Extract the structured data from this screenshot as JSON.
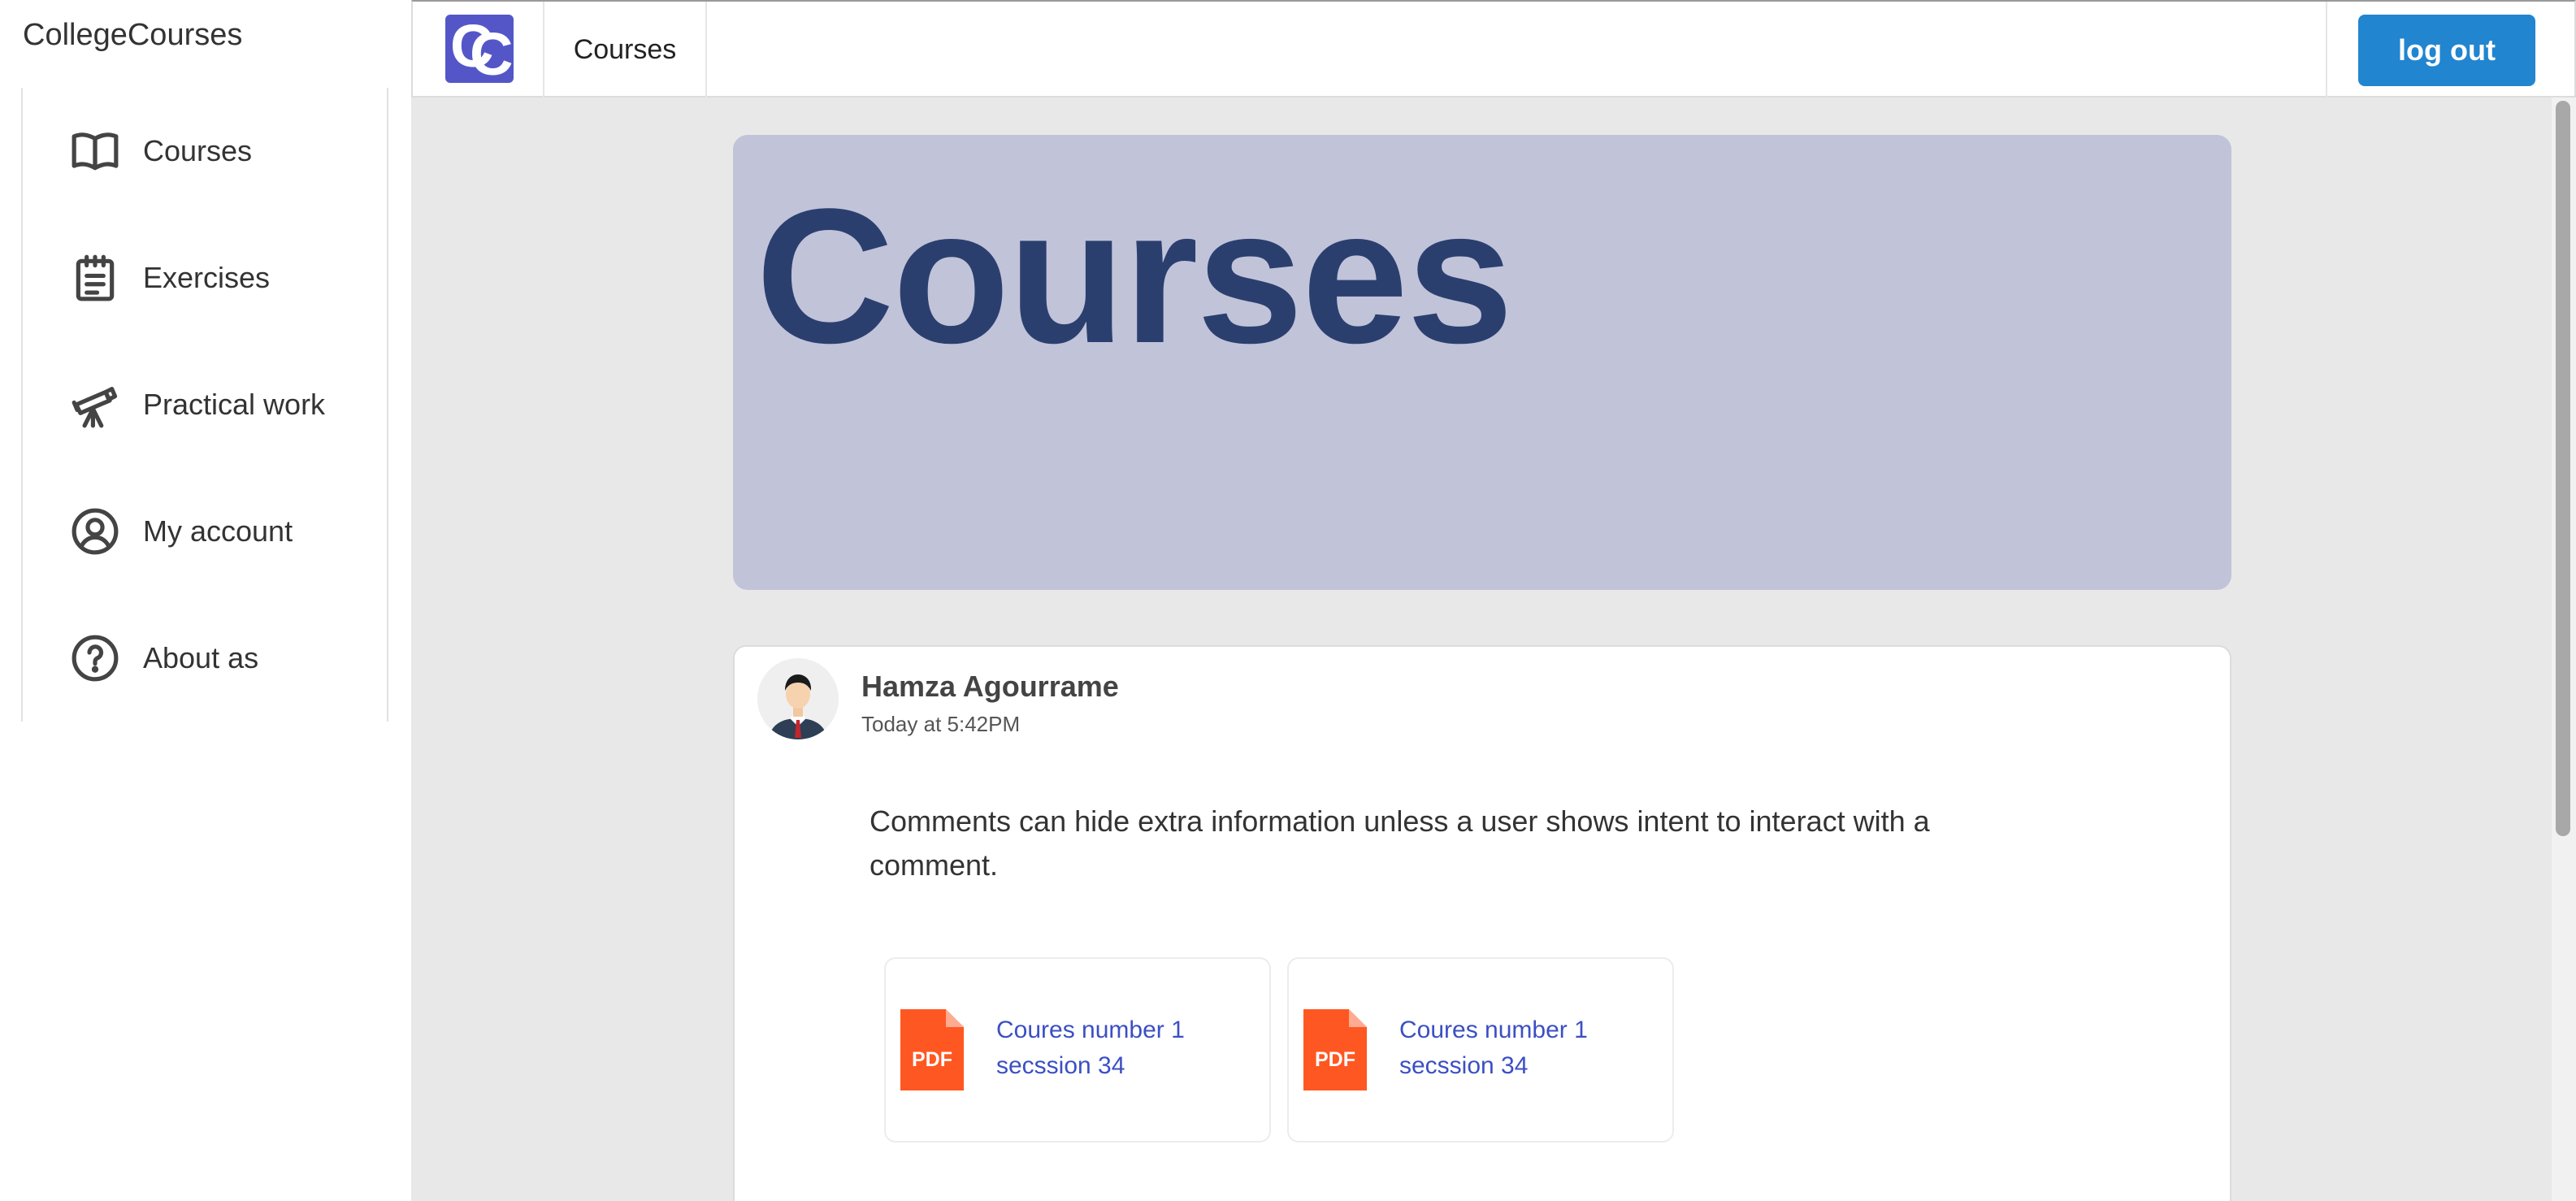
{
  "app": {
    "brand": "CollegeCourses"
  },
  "sidebar": {
    "items": [
      {
        "label": "Courses",
        "icon": "book-open-icon"
      },
      {
        "label": "Exercises",
        "icon": "notepad-icon"
      },
      {
        "label": "Practical work",
        "icon": "telescope-icon"
      },
      {
        "label": "My account",
        "icon": "user-circle-icon"
      },
      {
        "label": "About as",
        "icon": "question-circle-icon"
      }
    ]
  },
  "topbar": {
    "logo_letters": [
      "C",
      "C"
    ],
    "nav_item": "Courses",
    "logout_label": "log out"
  },
  "hero": {
    "title": "Courses"
  },
  "post": {
    "author": "Hamza Agourrame",
    "time": "Today at 5:42PM",
    "text": "Comments can hide extra information unless a user shows intent to interact with a comment.",
    "attachments": [
      {
        "name": "Coures number 1 secssion 34",
        "type_label": "PDF"
      },
      {
        "name": "Coures number 1 secssion 34",
        "type_label": "PDF"
      }
    ]
  },
  "colors": {
    "logo_bg": "#5456c8",
    "hero_bg": "#c1c3d9",
    "hero_title": "#2b3f6f",
    "logout_bg": "#2185d0",
    "link": "#3b4fc4",
    "pdf": "#ff5722"
  }
}
